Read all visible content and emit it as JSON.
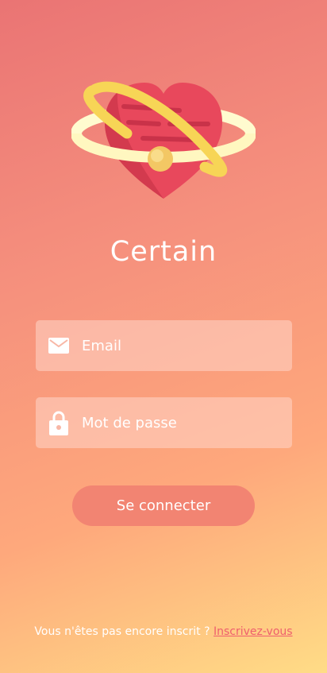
{
  "app": {
    "title": "Certain"
  },
  "login": {
    "email_placeholder": "Email",
    "password_placeholder": "Mot de passe",
    "submit_label": "Se connecter"
  },
  "signup": {
    "prompt": "Vous n'êtes pas encore inscrit ?",
    "link_label": "Inscrivez-vous"
  },
  "icons": {
    "logo": "heart-with-orbit-ring",
    "email": "envelope-icon",
    "password": "padlock-icon"
  },
  "colors": {
    "gradient_top": "#ea7474",
    "gradient_bottom": "#ffdc86",
    "button": "#f28472",
    "link": "#ef5e6d"
  }
}
